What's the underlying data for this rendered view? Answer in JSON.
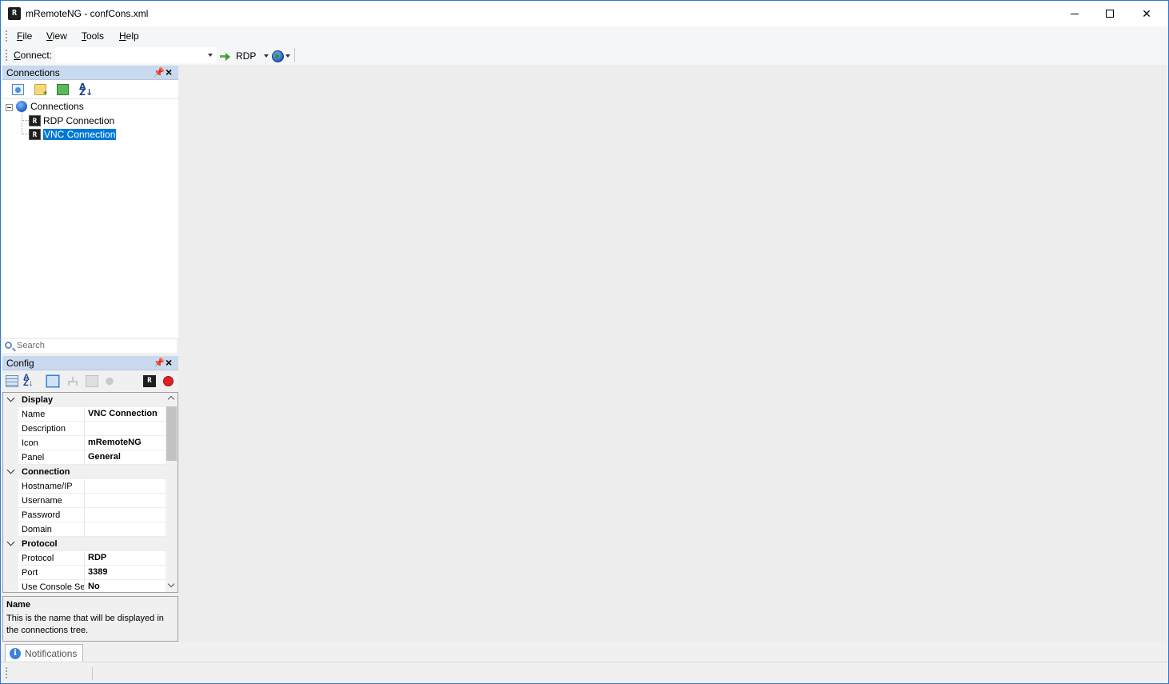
{
  "window": {
    "title": "mRemoteNG - confCons.xml",
    "app_icon_text": "R"
  },
  "menu": {
    "file_prefix": "",
    "file_u": "F",
    "file_rest": "ile",
    "view_u": "V",
    "view_rest": "iew",
    "tools_u": "T",
    "tools_rest": "ools",
    "help_u": "H",
    "help_rest": "elp"
  },
  "quick_connect": {
    "label_u": "C",
    "label_rest": "onnect:",
    "input_value": "",
    "protocol_label": "RDP"
  },
  "connections_panel": {
    "title": "Connections",
    "pin_glyph": "⊥",
    "close_glyph": "✕",
    "sort_glyph": "A↓Z",
    "tree": {
      "root_label": "Connections",
      "items": [
        {
          "label": "RDP Connection",
          "icon_text": "R",
          "selected": false
        },
        {
          "label": "VNC Connection",
          "icon_text": "R",
          "selected": true
        }
      ]
    },
    "search_placeholder": "Search"
  },
  "config_panel": {
    "title": "Config",
    "pin_glyph": "⊥",
    "close_glyph": "✕",
    "icon_r_text": "R",
    "categories": [
      {
        "name": "Display",
        "props": [
          {
            "name": "Name",
            "value": "VNC Connection"
          },
          {
            "name": "Description",
            "value": ""
          },
          {
            "name": "Icon",
            "value": "mRemoteNG"
          },
          {
            "name": "Panel",
            "value": "General"
          }
        ]
      },
      {
        "name": "Connection",
        "props": [
          {
            "name": "Hostname/IP",
            "value": ""
          },
          {
            "name": "Username",
            "value": ""
          },
          {
            "name": "Password",
            "value": ""
          },
          {
            "name": "Domain",
            "value": ""
          }
        ]
      },
      {
        "name": "Protocol",
        "props": [
          {
            "name": "Protocol",
            "value": "RDP"
          },
          {
            "name": "Port",
            "value": "3389"
          },
          {
            "name": "Use Console Session",
            "value": "No"
          }
        ]
      }
    ],
    "help": {
      "title": "Name",
      "description": "This is the name that will be displayed in the connections tree."
    }
  },
  "notifications": {
    "tab_label": "Notifications",
    "info_glyph": "i"
  },
  "colors": {
    "accent": "#2b79d8",
    "selection": "#0078d7",
    "panel_header": "#c9d9ee",
    "workspace": "#ededed"
  }
}
